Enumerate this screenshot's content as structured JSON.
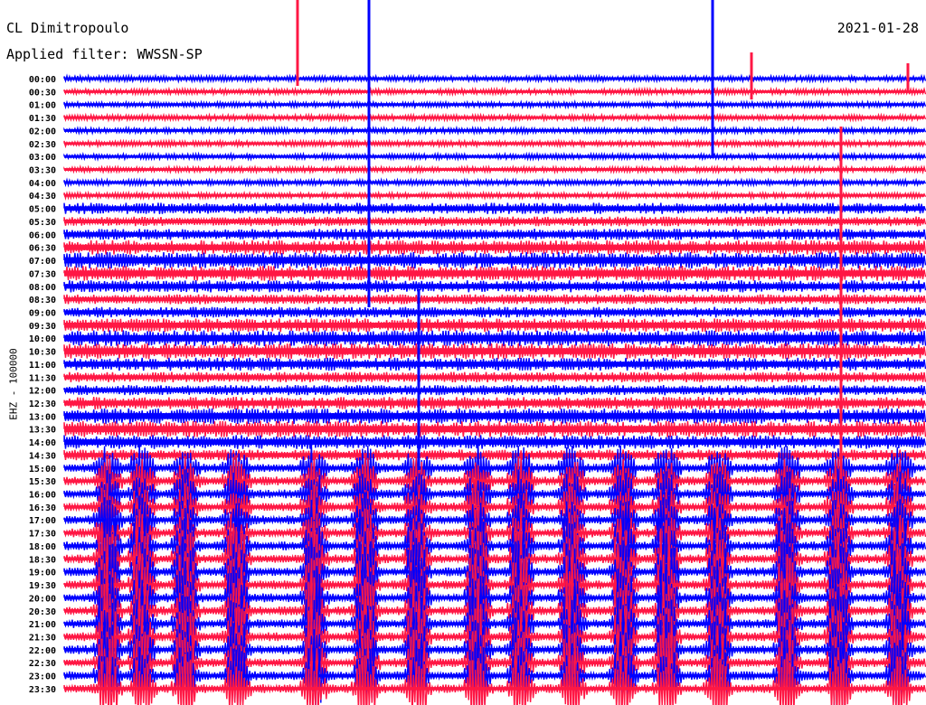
{
  "header": {
    "station": "CL Dimitropoulo",
    "filter": "Applied filter: WWSSN-SP",
    "date": "2021-01-28"
  },
  "chart_data": {
    "type": "helicorder",
    "ylabel": "EHZ - 100000",
    "time_labels": [
      "00:00",
      "00:30",
      "01:00",
      "01:30",
      "02:00",
      "02:30",
      "03:00",
      "03:30",
      "04:00",
      "04:30",
      "05:00",
      "05:30",
      "06:00",
      "06:30",
      "07:00",
      "07:30",
      "08:00",
      "08:30",
      "09:00",
      "09:30",
      "10:00",
      "10:30",
      "11:00",
      "11:30",
      "12:00",
      "12:30",
      "13:00",
      "13:30",
      "14:00",
      "14:30",
      "15:00",
      "15:30",
      "16:00",
      "16:30",
      "17:00",
      "17:30",
      "18:00",
      "18:30",
      "19:00",
      "19:30",
      "20:00",
      "20:30",
      "21:00",
      "21:30",
      "22:00",
      "22:30",
      "23:00",
      "23:30"
    ],
    "colors": [
      "#0000ff",
      "#ff1744"
    ],
    "grid": false
  }
}
